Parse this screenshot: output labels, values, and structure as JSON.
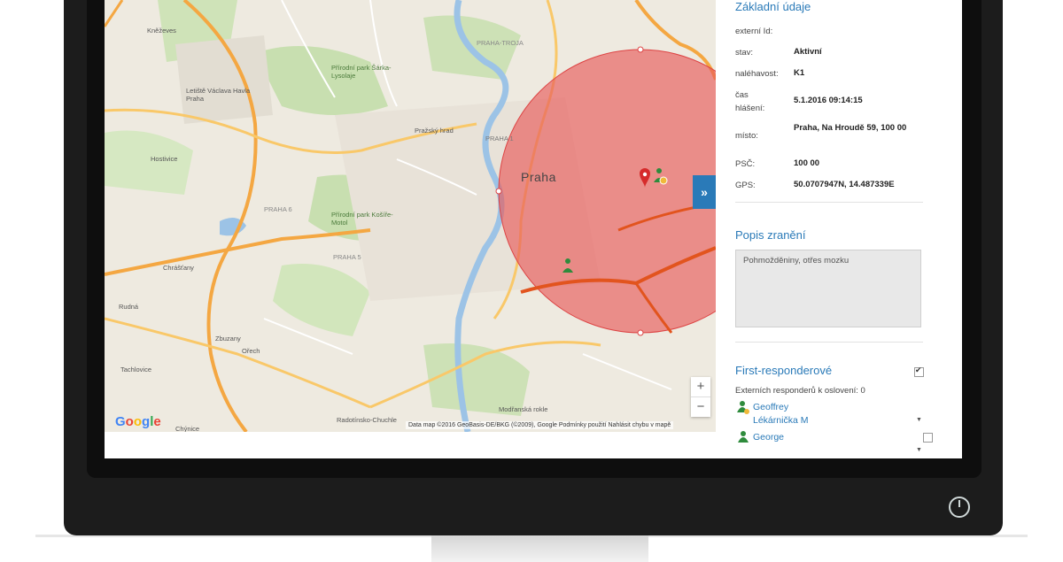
{
  "map": {
    "labels": {
      "knezeves": "Kněževes",
      "lenin_airport": "Letiště Václava Havla Praha",
      "hostivice": "Hostivice",
      "chrastany": "Chrášťany",
      "rudna": "Rudná",
      "zbuzany": "Zbuzany",
      "ochoz": "Ořech",
      "tachlovice": "Tachlovice",
      "chrustenice": "Chýnice",
      "praha": "Praha",
      "praha1": "PRAHA 1",
      "park_sarka": "Přírodní park Šárka-Lysolaje",
      "park_kotire": "Přírodní park Košíře-Motol",
      "prazsky_hrad": "Pražský hrad",
      "praha_troja": "PRAHA-TROJA",
      "praha6": "PRAHA 6",
      "praha5": "PRAHA 5",
      "modranska": "Modřanská rokle",
      "radotin": "Radotínsko-Chuchle"
    },
    "google_logo": "Google",
    "attribution": "Data map ©2016 GeoBasis-DE/BKG (©2009), Google    Podmínky použití    Nahlásit chybu v mapě",
    "zoom_in": "+",
    "zoom_out": "−",
    "expand_label": "»"
  },
  "panel": {
    "basic_title": "Základní údaje",
    "fields": [
      {
        "label": "externí Id:",
        "value": ""
      },
      {
        "label": "stav:",
        "value": "Aktivní"
      },
      {
        "label": "naléhavost:",
        "value": "K1"
      },
      {
        "label": "čas hlášení:",
        "value": "5.1.2016 09:14:15"
      },
      {
        "label": "místo:",
        "value": "Praha, Na Hroudě 59, 100 00"
      },
      {
        "label": "PSČ:",
        "value": "100 00"
      },
      {
        "label": "GPS:",
        "value": "50.0707947N, 14.487339E"
      }
    ],
    "injury_title": "Popis zranění",
    "injury_text": "Pohmožděniny, otřes mozku",
    "responders_title": "First-responderové",
    "external_count": "Externích responderů k oslovení: 0",
    "responders": [
      {
        "name": "Geoffrey",
        "role": "Lékárnička M"
      },
      {
        "name": "George",
        "role": ""
      }
    ]
  },
  "colors": {
    "accent": "#2a7ab8",
    "radius_fill": "#e85a5a"
  }
}
